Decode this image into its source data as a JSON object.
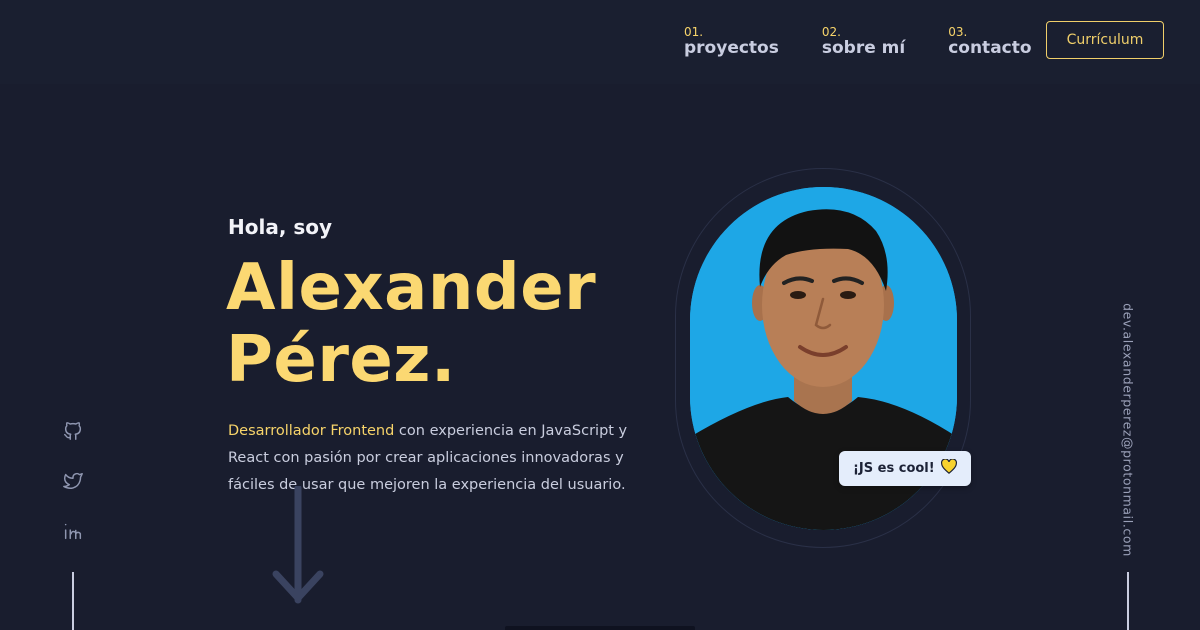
{
  "nav": {
    "items": [
      {
        "num": "01.",
        "label": "proyectos"
      },
      {
        "num": "02.",
        "label": "sobre mí"
      },
      {
        "num": "03.",
        "label": "contacto"
      }
    ],
    "resume_button": "Currículum"
  },
  "hero": {
    "greeting": "Hola, soy",
    "name_line1": "Alexander",
    "name_line2": "Pérez.",
    "role": "Desarrollador Frontend",
    "description": " con experiencia en JavaScript y React con pasión por crear aplicaciones innovadoras y fáciles de usar que mejoren la experiencia del usuario."
  },
  "photo": {
    "badge_text": "¡JS es cool!",
    "badge_icon": "yellow-heart-icon"
  },
  "social": {
    "icons": [
      "github-icon",
      "twitter-icon",
      "linkedin-icon"
    ]
  },
  "email": "dev.alexanderperez@protonmail.com",
  "colors": {
    "background": "#191d2e",
    "accent": "#fbd872",
    "photo_bg": "#1ea7e6"
  }
}
